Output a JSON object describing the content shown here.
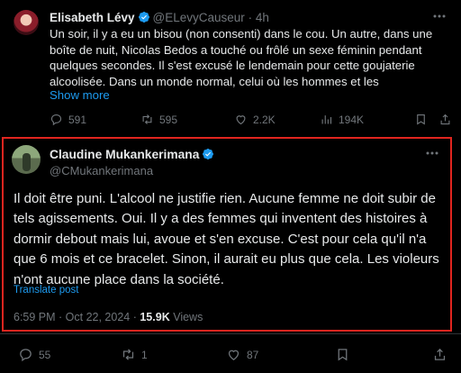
{
  "quoted_tweet": {
    "author_name": "Elisabeth Lévy",
    "author_handle": "@ELevyCauseur",
    "separator": "·",
    "time": "4h",
    "text": "Un soir, il y a eu un bisou (non consenti) dans le cou. Un autre, dans une boîte de nuit, Nicolas Bedos a touché ou frôlé un sexe féminin pendant quelques secondes. Il s'est excusé le lendemain pour cette goujaterie alcoolisée. Dans un monde normal, celui où  les hommes et les",
    "show_more": "Show more",
    "stats": {
      "replies": "591",
      "reposts": "595",
      "likes": "2.2K",
      "views": "194K"
    }
  },
  "main_tweet": {
    "author_name": "Claudine Mukankerimana",
    "author_handle": "@CMukankerimana",
    "text": "Il doit être puni. L'alcool ne justifie rien. Aucune femme ne doit subir de tels agissements. Oui. Il y a des femmes qui inventent des histoires à dormir debout mais lui, avoue et s'en excuse. C'est pour cela qu'il n'a que 6 mois et ce bracelet. Sinon, il aurait eu plus que cela. Les violeurs n'ont aucune place dans la société.",
    "translate": "Translate post",
    "timestamp": "6:59 PM · Oct 22, 2024 · ",
    "views_count": "15.9K",
    "views_label": "Views",
    "stats": {
      "replies": "55",
      "reposts": "1",
      "likes": "87"
    }
  },
  "colors": {
    "background": "#000000",
    "accent": "#1d9bf0",
    "muted": "#71767b",
    "highlight_border": "#e0251f",
    "verified": "#1d9bf0"
  },
  "icons": [
    "reply-icon",
    "repost-icon",
    "like-icon",
    "views-icon",
    "bookmark-icon",
    "share-icon",
    "more-icon",
    "verified-badge-icon"
  ]
}
